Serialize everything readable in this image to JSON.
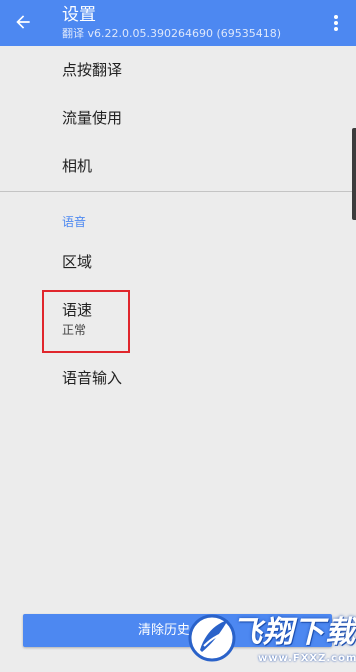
{
  "app_bar": {
    "title": "设置",
    "subtitle": "翻译 v6.22.0.05.390264690 (69535418)",
    "icons": {
      "back": "arrow-back-icon",
      "overflow": "more-vert-icon"
    }
  },
  "settings": {
    "items": [
      {
        "label": "点按翻译"
      },
      {
        "label": "流量使用"
      },
      {
        "label": "相机"
      }
    ],
    "voice_section": {
      "header": "语音",
      "items": [
        {
          "label": "区域"
        },
        {
          "label": "语速",
          "value": "正常"
        },
        {
          "label": "语音输入"
        }
      ]
    }
  },
  "clear_history_button": {
    "label": "清除历史"
  },
  "watermark": {
    "text": "飞翔下载",
    "url": "www.FXXZ.com"
  },
  "colors": {
    "primary": "#4d88f1",
    "background": "#ececec",
    "highlight_border": "#e0262c"
  }
}
